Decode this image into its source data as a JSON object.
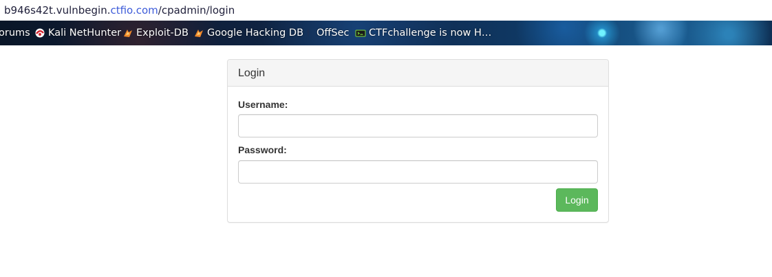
{
  "browser": {
    "url": {
      "host": "b946s42t.vulnbegin.",
      "domain": "ctfio.com",
      "path": "/cpadmin/login"
    },
    "bookmarks": [
      {
        "label": "orums",
        "icon": "none"
      },
      {
        "label": "Kali NetHunter",
        "icon": "nethunter-icon"
      },
      {
        "label": "Exploit-DB",
        "icon": "exploit-db-icon"
      },
      {
        "label": "Google Hacking DB",
        "icon": "ghdb-icon"
      },
      {
        "label": "OffSec",
        "icon": "offsec-icon"
      },
      {
        "label": "CTFchallenge is now H…",
        "icon": "ctfchallenge-icon"
      }
    ]
  },
  "login_panel": {
    "title": "Login",
    "username_label": "Username:",
    "username_value": "",
    "password_label": "Password:",
    "password_value": "",
    "submit_label": "Login"
  },
  "colors": {
    "submit_button": "#5cb85c",
    "panel_heading_bg": "#f5f5f5",
    "url_domain": "#3d5bd9"
  }
}
